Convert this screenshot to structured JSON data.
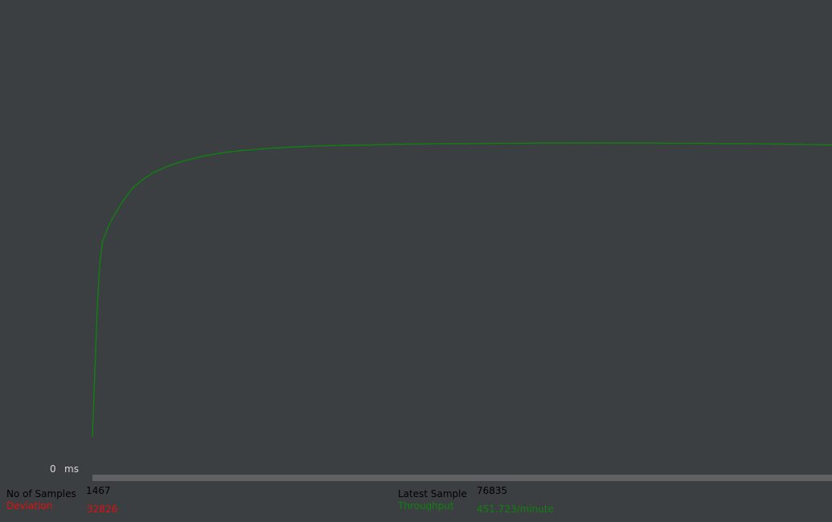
{
  "colors": {
    "background": "#3c3f41",
    "throughput": "#108010",
    "deviation": "#e01010",
    "label": "#000000",
    "axis_text": "#d8d8d8"
  },
  "axis": {
    "zero_label": "0",
    "unit_label": "ms"
  },
  "stats": {
    "samples_label": "No of Samples",
    "samples_value": "1467",
    "deviation_label": "Deviation",
    "deviation_value": "32826",
    "latest_label": "Latest Sample",
    "latest_value": "76835",
    "throughput_label": "Throughput",
    "throughput_value": "451.723/minute"
  },
  "chart_data": {
    "type": "line",
    "x": [
      0,
      5,
      10,
      15,
      20,
      30,
      40,
      60,
      80,
      100,
      120,
      150,
      180,
      220,
      260,
      300,
      350,
      400,
      450,
      500,
      550,
      600,
      650,
      700,
      750,
      800,
      850,
      900,
      950,
      1000,
      1050,
      1100,
      1150,
      1200,
      1250,
      1300,
      1350,
      1400,
      1467
    ],
    "series": [
      {
        "values": [
          0.1,
          0.3,
          0.5,
          0.62,
          0.68,
          0.72,
          0.75,
          0.8,
          0.84,
          0.865,
          0.885,
          0.905,
          0.92,
          0.935,
          0.945,
          0.952,
          0.958,
          0.962,
          0.965,
          0.967,
          0.968,
          0.97,
          0.971,
          0.972,
          0.972,
          0.973,
          0.973,
          0.974,
          0.974,
          0.974,
          0.974,
          0.974,
          0.973,
          0.973,
          0.972,
          0.972,
          0.971,
          0.97,
          0.968
        ]
      }
    ],
    "xlim": [
      0,
      1467
    ],
    "ylim": [
      0,
      1.4
    ],
    "grid": false
  }
}
